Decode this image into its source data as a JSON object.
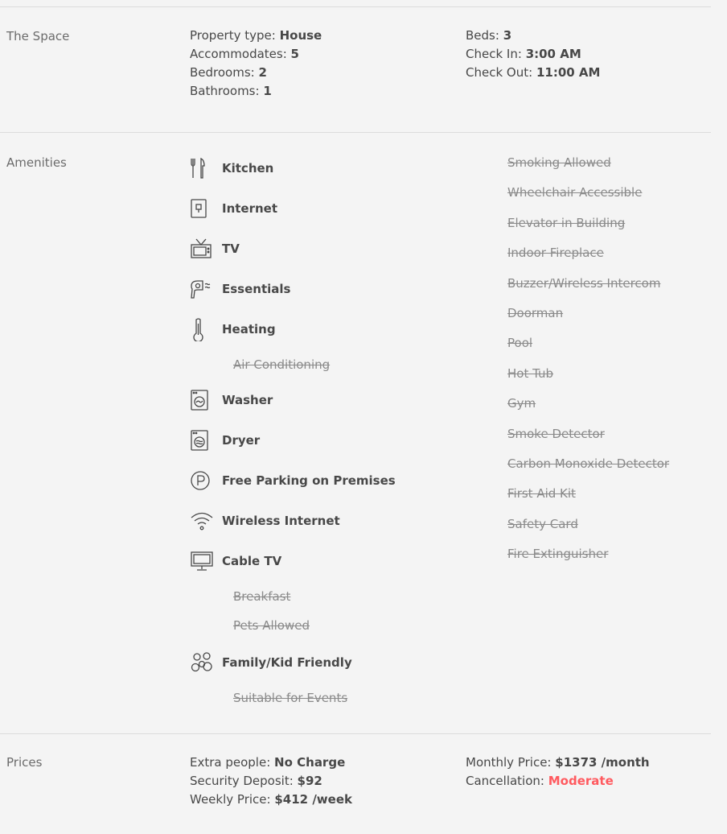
{
  "space": {
    "label": "The Space",
    "property_type_key": "Property type:",
    "property_type": "House",
    "accommodates_key": "Accommodates:",
    "accommodates": "5",
    "bedrooms_key": "Bedrooms:",
    "bedrooms": "2",
    "bathrooms_key": "Bathrooms:",
    "bathrooms": "1",
    "beds_key": "Beds:",
    "beds": "3",
    "checkin_key": "Check In:",
    "checkin": "3:00 AM",
    "checkout_key": "Check Out:",
    "checkout": "11:00 AM"
  },
  "amenities": {
    "label": "Amenities",
    "available": [
      {
        "label": "Kitchen",
        "icon": "kitchen-icon"
      },
      {
        "label": "Internet",
        "icon": "internet-icon"
      },
      {
        "label": "TV",
        "icon": "tv-icon"
      },
      {
        "label": "Essentials",
        "icon": "hairdryer-icon"
      },
      {
        "label": "Heating",
        "icon": "thermometer-icon"
      },
      {
        "label": "Air Conditioning",
        "icon": ""
      },
      {
        "label": "Washer",
        "icon": "washer-icon"
      },
      {
        "label": "Dryer",
        "icon": "dryer-icon"
      },
      {
        "label": "Free Parking on Premises",
        "icon": "parking-icon"
      },
      {
        "label": "Wireless Internet",
        "icon": "wifi-icon"
      },
      {
        "label": "Cable TV",
        "icon": "cable-tv-icon"
      },
      {
        "label": "Breakfast",
        "icon": ""
      },
      {
        "label": "Pets Allowed",
        "icon": ""
      },
      {
        "label": "Family/Kid Friendly",
        "icon": "family-icon"
      },
      {
        "label": "Suitable for Events",
        "icon": ""
      }
    ],
    "unavailable": [
      "Smoking Allowed",
      "Wheelchair Accessible",
      "Elevator in Building",
      "Indoor Fireplace",
      "Buzzer/Wireless Intercom",
      "Doorman",
      "Pool",
      "Hot Tub",
      "Gym",
      "Smoke Detector",
      "Carbon Monoxide Detector",
      "First Aid Kit",
      "Safety Card",
      "Fire Extinguisher"
    ]
  },
  "prices": {
    "label": "Prices",
    "extra_people_key": "Extra people:",
    "extra_people": "No Charge",
    "deposit_key": "Security Deposit:",
    "deposit": "$92",
    "weekly_key": "Weekly Price:",
    "weekly": "$412 /week",
    "monthly_key": "Monthly Price:",
    "monthly": "$1373 /month",
    "cancellation_key": "Cancellation:",
    "cancellation": "Moderate",
    "cancellation_color": "#ff5a5f"
  }
}
